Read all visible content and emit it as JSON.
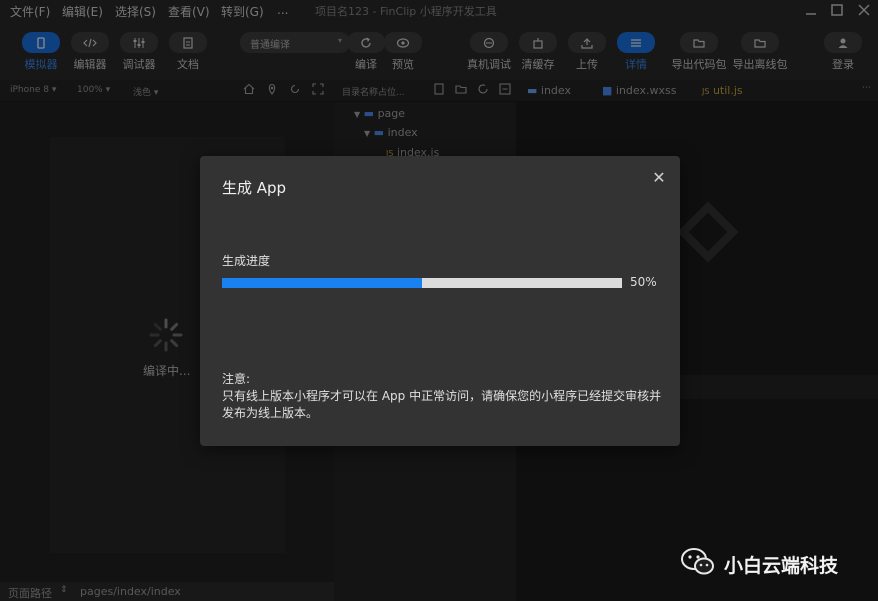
{
  "menubar": {
    "items": [
      "文件(F)",
      "编辑(E)",
      "选择(S)",
      "查看(V)",
      "转到(G)",
      "..."
    ],
    "title": "项目名123 - FinClip 小程序开发工具"
  },
  "toolbar": {
    "left_buttons": [
      {
        "label": "模拟器",
        "icon": "phone-icon",
        "active": true
      },
      {
        "label": "编辑器",
        "icon": "code-icon",
        "active": false
      },
      {
        "label": "调试器",
        "icon": "sliders-icon",
        "active": false
      },
      {
        "label": "文档",
        "icon": "document-icon",
        "active": false
      }
    ],
    "compile_mode": "普通编译",
    "compile_label": "编译",
    "preview_label": "预览",
    "right_buttons": [
      {
        "label": "真机调试",
        "icon": "debug-icon",
        "active": false
      },
      {
        "label": "清缓存",
        "icon": "broom-icon",
        "active": false
      },
      {
        "label": "上传",
        "icon": "upload-icon",
        "active": false
      },
      {
        "label": "详情",
        "icon": "menu-icon",
        "active": true
      },
      {
        "label": "导出代码包",
        "icon": "folder-icon",
        "active": false
      },
      {
        "label": "导出离线包",
        "icon": "folder-icon",
        "active": false
      }
    ],
    "login_label": "登录"
  },
  "subbar": {
    "device": "iPhone 8",
    "zoom": "100%",
    "theme": "浅色",
    "search_placeholder": "目录名称占位..."
  },
  "tabs": [
    {
      "label": "index",
      "icon": "folder-icon"
    },
    {
      "label": "index.wxss",
      "icon": "css-file-icon"
    },
    {
      "label": "util.js",
      "icon": "js-file-icon"
    }
  ],
  "tree": {
    "items": [
      {
        "label": "page"
      },
      {
        "label": "index"
      },
      {
        "label": "index.js"
      }
    ]
  },
  "simulator": {
    "loading_text": "编译中..."
  },
  "statusbar": {
    "label": "页面路径",
    "path": "pages/index/index"
  },
  "modal": {
    "title": "生成 App",
    "progress_label": "生成进度",
    "progress_value": 0.5,
    "progress_text": "50%",
    "note_title": "注意:",
    "note_body": "只有线上版本小程序才可以在 App 中正常访问，请确保您的小程序已经提交审核并发布为线上版本。"
  },
  "watermark": {
    "text": "小白云端科技"
  },
  "colors": {
    "accent": "#1a82f0",
    "modal_bg": "#333333",
    "track": "#dcdcdc"
  }
}
